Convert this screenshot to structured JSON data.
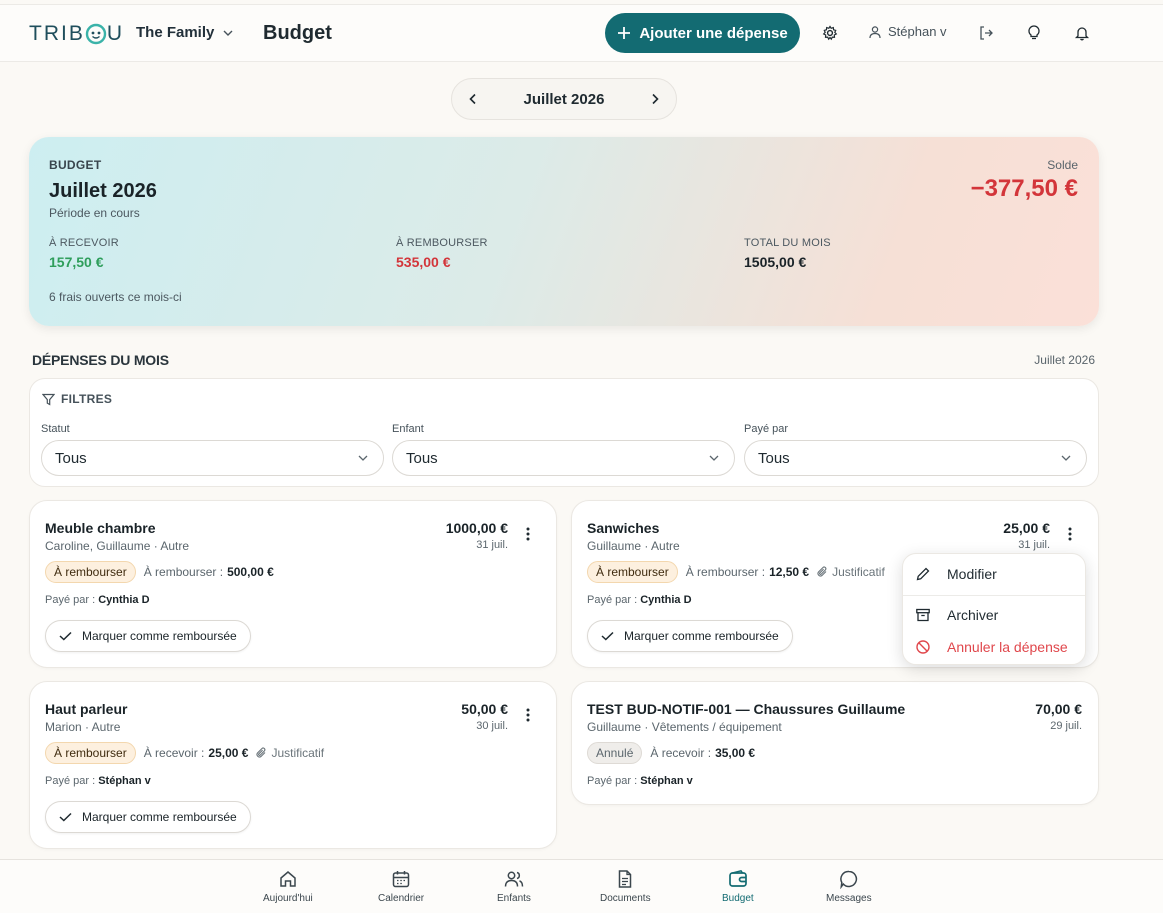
{
  "header": {
    "logo_left": "TRIB",
    "logo_right": "U",
    "family": "The Family",
    "page_title": "Budget",
    "add_button": "Ajouter une dépense",
    "user": "Stéphan v",
    "accent": "#136b72"
  },
  "month_nav": {
    "label": "Juillet 2026"
  },
  "budget": {
    "eyebrow": "BUDGET",
    "title": "Juillet 2026",
    "subtitle": "Période en cours",
    "solde_label": "Solde",
    "solde_value": "−377,50 €",
    "to_receive_label": "À RECEVOIR",
    "to_receive_value": "157,50 €",
    "to_reimburse_label": "À REMBOURSER",
    "to_reimburse_value": "535,00 €",
    "total_label": "TOTAL DU MOIS",
    "total_value": "1505,00 €",
    "footer": "6 frais ouverts ce mois-ci",
    "colors": {
      "positive": "#2e9e5b",
      "negative": "#d3353a"
    }
  },
  "section": {
    "title": "DÉPENSES DU MOIS",
    "month": "Juillet 2026"
  },
  "filters": {
    "title": "FILTRES",
    "statut": {
      "label": "Statut",
      "value": "Tous"
    },
    "enfant": {
      "label": "Enfant",
      "value": "Tous"
    },
    "paye_par": {
      "label": "Payé par",
      "value": "Tous"
    }
  },
  "expenses": [
    {
      "title": "Meuble chambre",
      "meta": "Caroline, Guillaume · Autre",
      "amount": "1000,00 €",
      "date": "31 juil.",
      "badge": "À rembourser",
      "detail_label": "À rembourser :",
      "detail_value": "500,00 €",
      "justificatif": "",
      "payer_label": "Payé par :",
      "payer": "Cynthia D",
      "mark_button": "Marquer comme remboursée"
    },
    {
      "title": "Sanwiches",
      "meta": "Guillaume · Autre",
      "amount": "25,00 €",
      "date": "31 juil.",
      "badge": "À rembourser",
      "detail_label": "À rembourser :",
      "detail_value": "12,50 €",
      "justificatif": "Justificatif",
      "payer_label": "Payé par :",
      "payer": "Cynthia D",
      "mark_button": "Marquer comme remboursée"
    },
    {
      "title": "Haut parleur",
      "meta": "Marion · Autre",
      "amount": "50,00 €",
      "date": "30 juil.",
      "badge": "À rembourser",
      "detail_label": "À recevoir :",
      "detail_value": "25,00 €",
      "justificatif": "Justificatif",
      "payer_label": "Payé par :",
      "payer": "Stéphan v",
      "mark_button": "Marquer comme remboursée"
    },
    {
      "title": "TEST BUD-NOTIF-001 — Chaussures Guillaume",
      "meta": "Guillaume · Vêtements / équipement",
      "amount": "70,00 €",
      "date": "29 juil.",
      "badge": "Annulé",
      "detail_label": "À recevoir :",
      "detail_value": "35,00 €",
      "justificatif": "",
      "payer_label": "Payé par :",
      "payer": "Stéphan v",
      "mark_button": ""
    }
  ],
  "menu": {
    "edit": "Modifier",
    "archive": "Archiver",
    "cancel": "Annuler la dépense"
  },
  "bottom_nav": [
    {
      "label": "Aujourd'hui",
      "icon": "home-icon"
    },
    {
      "label": "Calendrier",
      "icon": "calendar-icon"
    },
    {
      "label": "Enfants",
      "icon": "users-icon"
    },
    {
      "label": "Documents",
      "icon": "document-icon"
    },
    {
      "label": "Budget",
      "icon": "wallet-icon",
      "active": true
    },
    {
      "label": "Messages",
      "icon": "message-icon"
    }
  ]
}
